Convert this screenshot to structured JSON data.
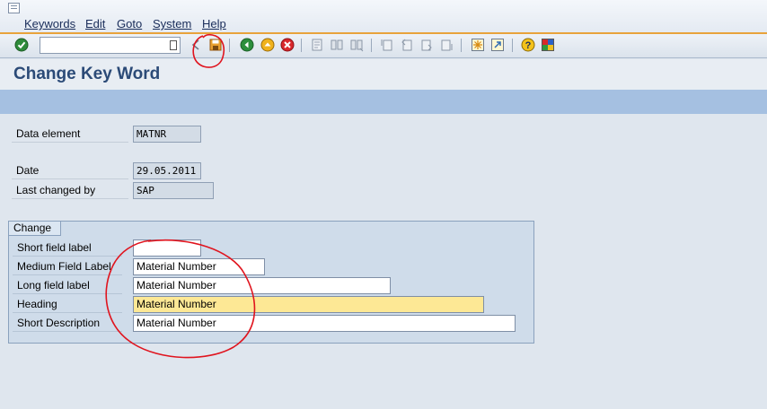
{
  "menu": {
    "items": [
      "Keywords",
      "Edit",
      "Goto",
      "System",
      "Help"
    ]
  },
  "toolbar": {
    "command_value": "",
    "icons": [
      "enter-icon",
      "command-dropdown-icon",
      "back-arrow-icon",
      "save-icon",
      "back-icon",
      "exit-icon",
      "cancel-icon",
      "print-icon",
      "find-icon",
      "find-next-icon",
      "first-page-icon",
      "previous-page-icon",
      "next-page-icon",
      "last-page-icon",
      "create-session-icon",
      "shortcut-icon",
      "help-icon",
      "layout-icon"
    ]
  },
  "page": {
    "title": "Change Key Word"
  },
  "header_fields": {
    "data_element_label": "Data element",
    "data_element_value": "MATNR",
    "date_label": "Date",
    "date_value": "29.05.2011",
    "last_changed_label": "Last changed by",
    "last_changed_value": "SAP"
  },
  "change_group": {
    "title": "Change",
    "short_label": "Short field label",
    "short_value": "",
    "medium_label": "Medium Field Label",
    "medium_value": "Material Number",
    "long_label": "Long field label",
    "long_value": "Material Number",
    "heading_label": "Heading",
    "heading_value": "Material Number",
    "short_desc_label": "Short Description",
    "short_desc_value": "Material Number"
  },
  "colors": {
    "title": "#2b4a77",
    "app_toolbar": "#a5c0e1",
    "focus_field": "#fde895",
    "annotation": "#e0141e",
    "accent_line": "#e8a33b"
  }
}
